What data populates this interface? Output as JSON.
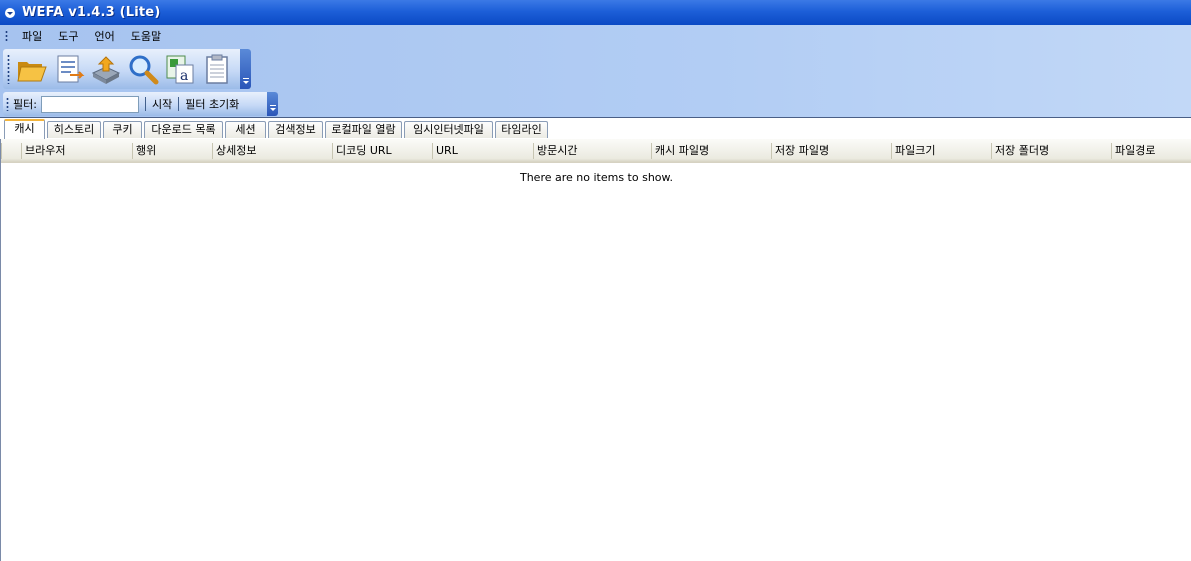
{
  "window": {
    "title": "WEFA v1.4.3 (Lite)"
  },
  "menubar": {
    "items": [
      "파일",
      "도구",
      "언어",
      "도움말"
    ]
  },
  "toolbar": {
    "buttons": [
      "open-folder-icon",
      "report-icon",
      "export-icon",
      "search-icon",
      "text-file-icon",
      "notepad-icon"
    ]
  },
  "filterbar": {
    "label": "필터:",
    "input_value": "",
    "start_label": "시작",
    "reset_label": "필터 초기화"
  },
  "tabs": [
    "캐시",
    "히스토리",
    "쿠키",
    "다운로드 목록",
    "세션",
    "검색정보",
    "로컬파일 열람",
    "임시인터넷파일",
    "타임라인"
  ],
  "active_tab": "캐시",
  "table": {
    "columns": [
      "브라우저",
      "행위",
      "상세정보",
      "디코딩 URL",
      "URL",
      "방문시간",
      "캐시 파일명",
      "저장 파일명",
      "파일크기",
      "저장 폴더명",
      "파일경로"
    ],
    "rows": [],
    "empty_message": "There are no items to show."
  }
}
